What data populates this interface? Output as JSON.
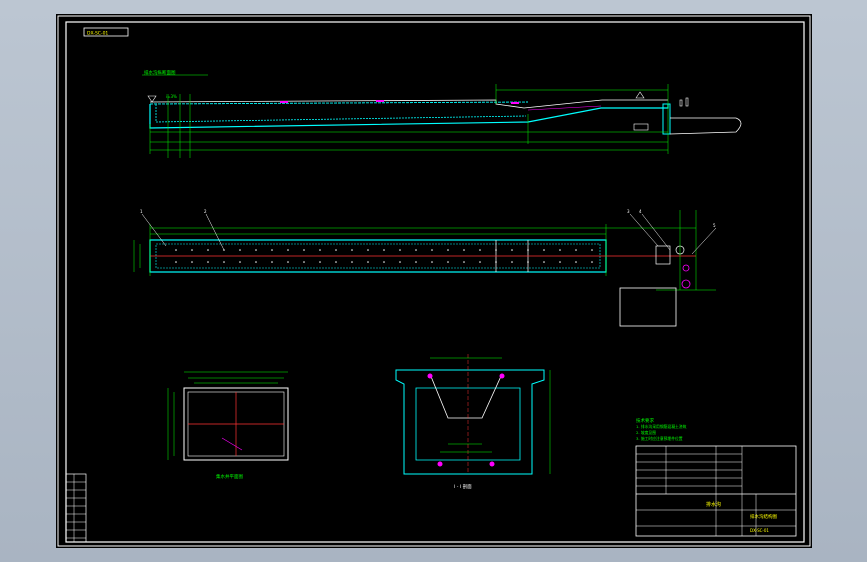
{
  "drawing": {
    "code_box_text": "DX-SC-01",
    "profile_label": "排水沟纵断面图",
    "slope_label": "i=3%",
    "section_caption": "I - I 剖面",
    "plan_caption": "集水井平面图",
    "notes_title": "技术要求",
    "notes": [
      "1. 排水沟采用钢筋混凝土浇筑",
      "2. 坡度见图",
      "3. 施工时应注意预埋件位置"
    ],
    "title_block": {
      "name": "排水沟",
      "drawing_title": "排水沟结构图",
      "drawing_no": "DX-SC-01"
    },
    "callouts": [
      "1",
      "2",
      "3",
      "4",
      "5"
    ]
  },
  "colors": {
    "sheet_background": "#000000",
    "frame": "#ffffff",
    "dimension": "#00ff00",
    "outline": "#00ffff",
    "center_line": "#ff3333",
    "magenta": "#ff00ff",
    "yellow": "#ffff00"
  }
}
